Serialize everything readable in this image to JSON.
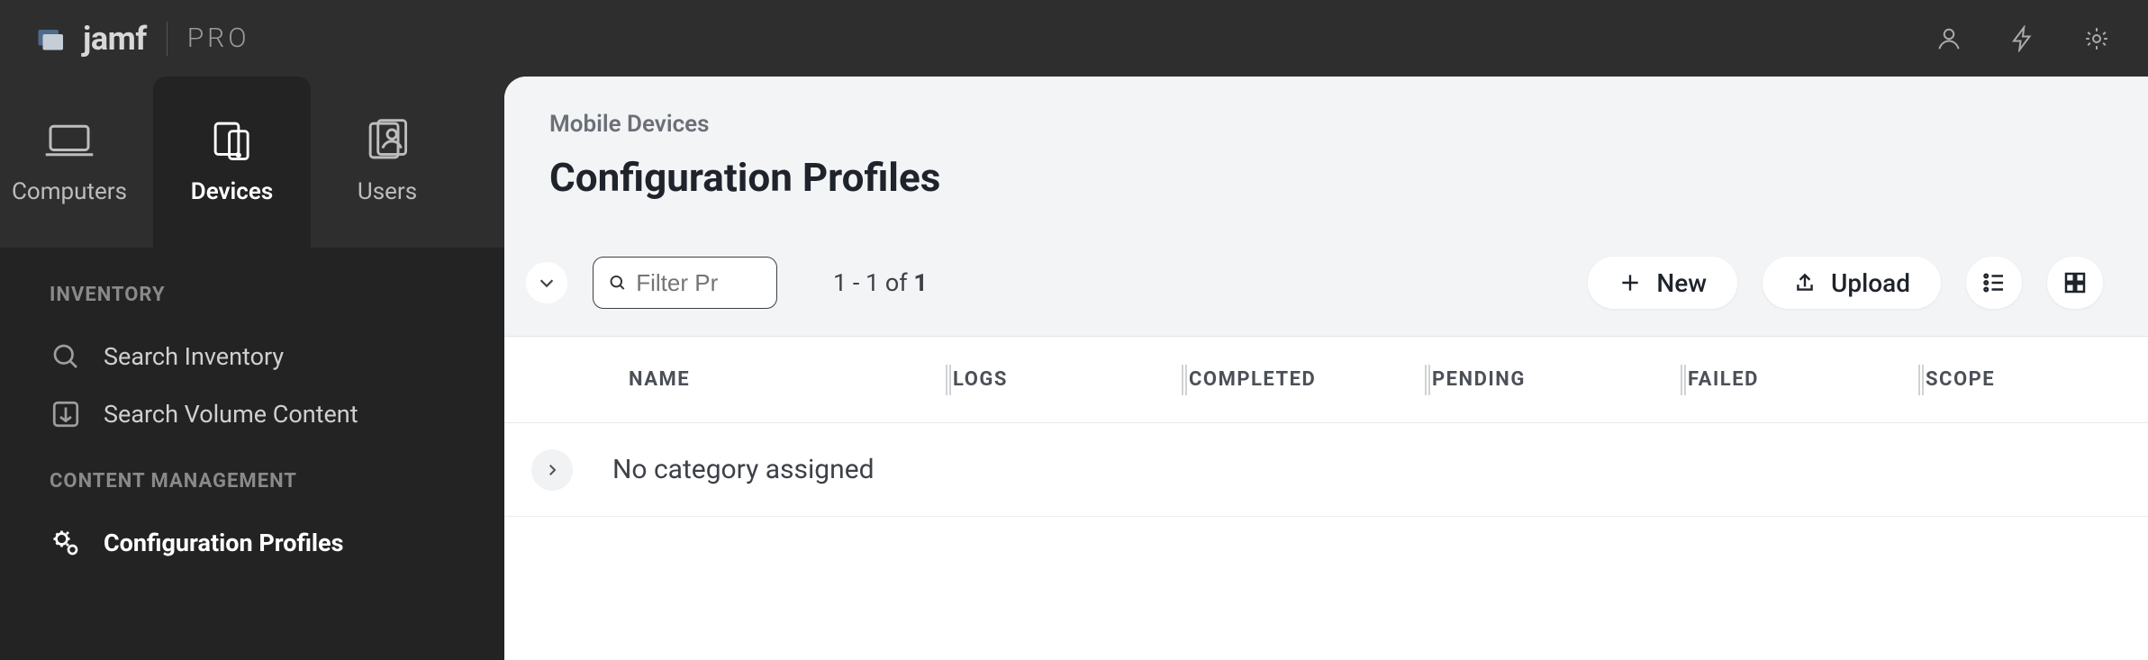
{
  "brand": {
    "jamf": "jamf",
    "pro": "PRO"
  },
  "tabs": {
    "computers": "Computers",
    "devices": "Devices",
    "users": "Users"
  },
  "sidebar": {
    "section_inventory": "INVENTORY",
    "search_inventory": "Search Inventory",
    "search_volume_content": "Search Volume Content",
    "section_content": "CONTENT MANAGEMENT",
    "configuration_profiles": "Configuration Profiles"
  },
  "header": {
    "breadcrumb": "Mobile Devices",
    "title": "Configuration Profiles"
  },
  "toolbar": {
    "filter_placeholder": "Filter Pr",
    "range_prefix": "1 - 1 of ",
    "range_total": "1",
    "new_label": "New",
    "upload_label": "Upload"
  },
  "columns": {
    "name": "NAME",
    "logs": "LOGS",
    "completed": "COMPLETED",
    "pending": "PENDING",
    "failed": "FAILED",
    "scope": "SCOPE"
  },
  "group": {
    "label": "No category assigned"
  }
}
